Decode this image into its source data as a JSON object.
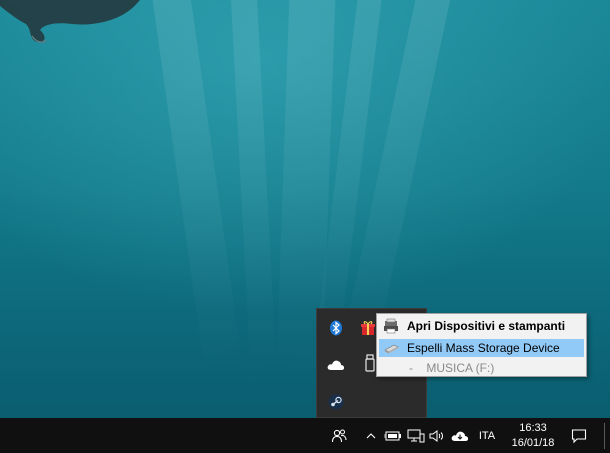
{
  "context_menu": {
    "items": [
      {
        "label": "Apri Dispositivi e stampanti",
        "icon": "devices-printers-icon",
        "style": "bold"
      },
      {
        "label": "Espelli Mass Storage Device",
        "icon": "usb-drive-icon",
        "style": "highlight"
      },
      {
        "label": "-    MUSICA (F:)",
        "icon": "",
        "style": "disabled"
      }
    ]
  },
  "tray_flyout": {
    "icons": [
      "bluetooth-icon",
      "gift-icon",
      "onedrive-icon",
      "safely-remove-hardware-icon",
      "steam-icon"
    ]
  },
  "taskbar": {
    "language": "ITA",
    "time": "16:33",
    "date": "16/01/18",
    "icons": [
      "people-icon",
      "show-hidden-icons-chevron",
      "battery-icon",
      "network-icon",
      "volume-icon",
      "onedrive-tray-icon",
      "action-center-icon"
    ]
  },
  "colors": {
    "menu_highlight": "#91c9f7",
    "taskbar_bg": "#101010",
    "flyout_bg": "#2b2b2b",
    "desktop_teal": "#137a8b"
  }
}
